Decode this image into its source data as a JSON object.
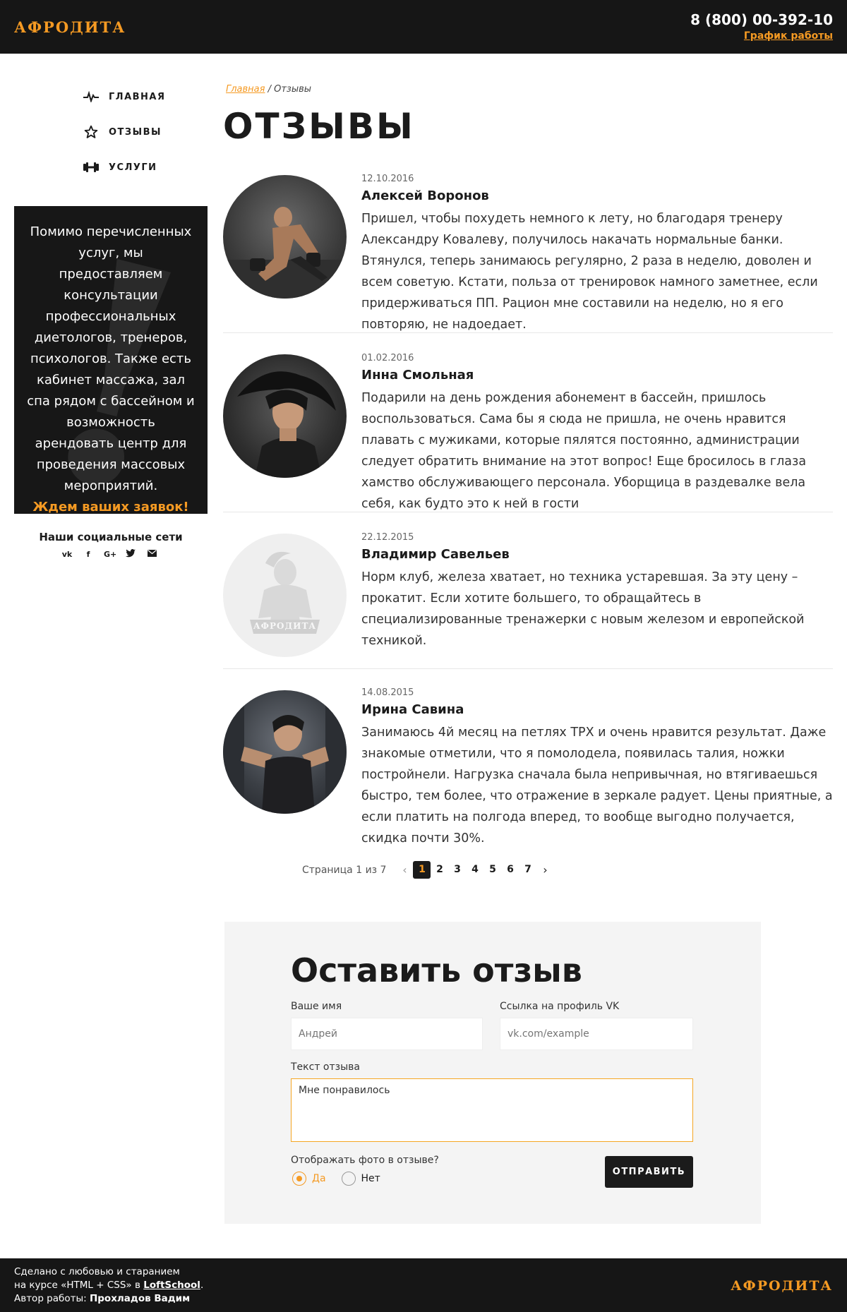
{
  "header": {
    "logo": "АФРОДИТА",
    "phone": "8 (800) 00-392-10",
    "schedule_link": "График работы"
  },
  "sidebar": {
    "nav": [
      {
        "label": "ГЛАВНАЯ",
        "icon": "pulse-icon"
      },
      {
        "label": "ОТЗЫВЫ",
        "icon": "star-icon"
      },
      {
        "label": "УСЛУГИ",
        "icon": "dumbbell-icon"
      }
    ],
    "promo": {
      "text": "Помимо перечисленных услуг, мы предоставляем консультации профессиональных диетологов, тренеров, психологов. Также есть кабинет массажа, зал спа рядом с бассейном и возможность арендовать центр для проведения массовых мероприятий.",
      "cta": "Ждем ваших заявок!"
    },
    "social_title": "Наши социальные сети",
    "social": [
      "vk-icon",
      "facebook-icon",
      "googleplus-icon",
      "twitter-icon",
      "email-icon"
    ]
  },
  "breadcrumb": {
    "home": "Главная",
    "current": "Отзывы"
  },
  "page_title": "ОТЗЫВЫ",
  "reviews": [
    {
      "date": "12.10.2016",
      "name": "Алексей Воронов",
      "text": "Пришел, чтобы похудеть немного к лету, но благодаря тренеру Александру Ковалеву, получилось накачать нормальные банки. Втянулся, теперь занимаюсь регулярно, 2 раза в неделю, доволен и всем советую. Кстати, польза от тренировок намного заметнее, если придерживаться ПП. Рацион мне составили на неделю, но я его повторяю, не надоедает."
    },
    {
      "date": "01.02.2016",
      "name": "Инна Смольная",
      "text": "Подарили на день рождения абонемент в бассейн, пришлось воспользоваться. Сама бы я сюда не пришла, не очень нравится плавать с мужиками, которые пялятся постоянно, администрации следует обратить внимание на этот вопрос! Еще бросилось в глаза хамство обслуживающего персонала. Уборщица в раздевалке вела себя, как будто это к ней в гости"
    },
    {
      "date": "22.12.2015",
      "name": "Владимир Савельев",
      "text": "Норм клуб, железа хватает, но техника устаревшая. За эту цену – прокатит. Если хотите большего, то обращайтесь в специализированные тренажерки с новым железом и европейской техникой.",
      "avatar_logo": "АФРОДИТА"
    },
    {
      "date": "14.08.2015",
      "name": "Ирина Савина",
      "text": "Занимаюсь 4й месяц на петлях TPX и очень нравится результат. Даже знакомые отметили, что я помолодела, появилась талия, ножки постройнели. Нагрузка сначала была непривычная, но втягиваешься быстро, тем более, что отражение в зеркале радует. Цены приятные, а если платить на полгода вперед, то вообще выгодно получается, скидка почти 30%."
    }
  ],
  "pagination": {
    "info": "Страница 1 из 7",
    "pages": [
      "1",
      "2",
      "3",
      "4",
      "5",
      "6",
      "7"
    ],
    "current": "1"
  },
  "form": {
    "title": "Оставить отзыв",
    "name_label": "Ваше имя",
    "name_placeholder": "Андрей",
    "vk_label": "Ссылка на профиль VK",
    "vk_placeholder": "vk.com/example",
    "text_label": "Текст отзыва",
    "text_value": "Мне понравилось",
    "photo_question": "Отображать фото в отзыве?",
    "option_yes": "Да",
    "option_no": "Нет",
    "submit": "ОТПРАВИТЬ"
  },
  "footer": {
    "line1": "Сделано с любовью и старанием",
    "line2_prefix": "на курсе «HTML + CSS» в ",
    "line2_link": "LoftSchool",
    "line2_suffix": ".",
    "line3_prefix": "Автор работы: ",
    "author": "Прохладов Вадим",
    "logo": "АФРОДИТА"
  },
  "colors": {
    "accent": "#f59a23",
    "dark": "#161616"
  }
}
